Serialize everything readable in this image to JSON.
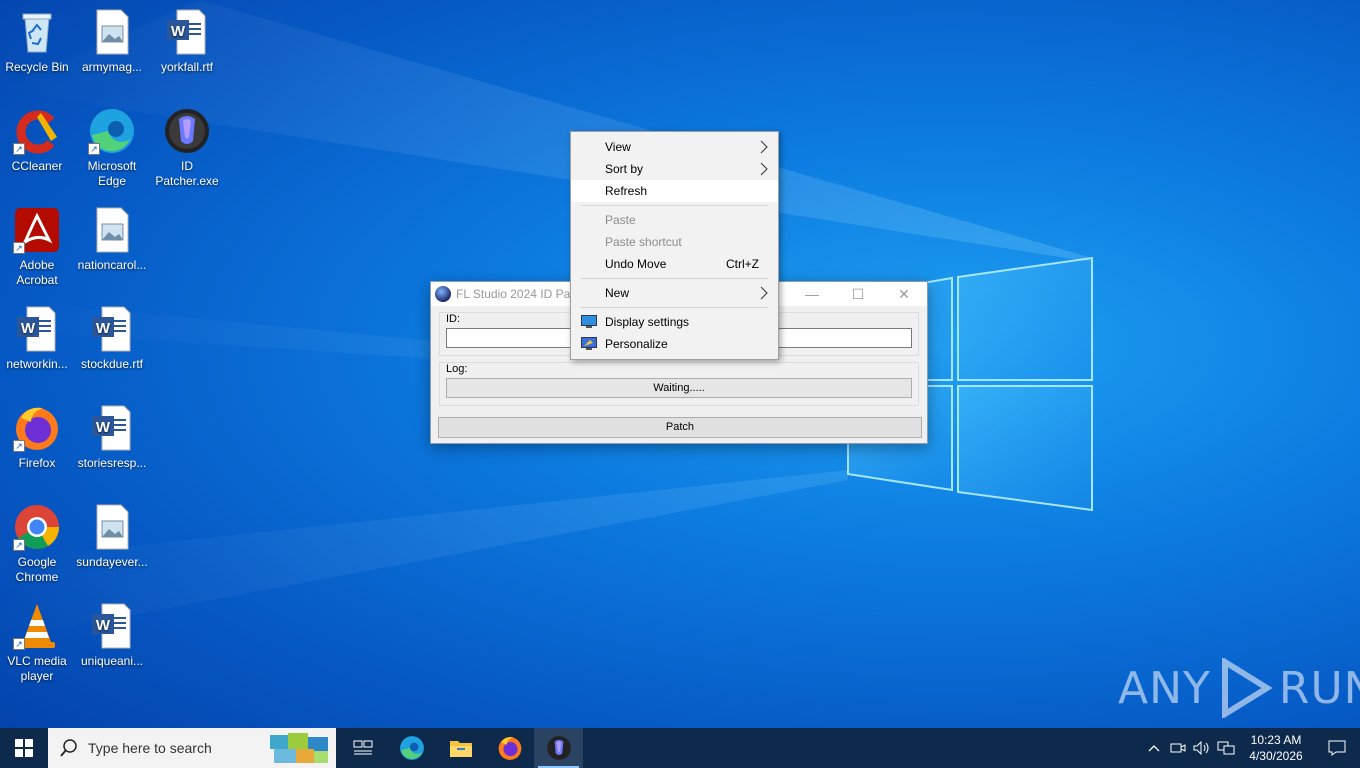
{
  "desktop": {
    "icons": [
      {
        "label": "Recycle Bin",
        "icon": "recycle-bin-icon"
      },
      {
        "label": "armymag...",
        "icon": "image-file-icon"
      },
      {
        "label": "yorkfall.rtf",
        "icon": "word-document-icon"
      },
      {
        "label": "CCleaner",
        "icon": "ccleaner-icon"
      },
      {
        "label": "Microsoft Edge",
        "icon": "edge-icon"
      },
      {
        "label": "ID Patcher.exe",
        "icon": "fl-studio-icon"
      },
      {
        "label": "Adobe Acrobat",
        "icon": "acrobat-icon"
      },
      {
        "label": "nationcarol...",
        "icon": "image-file-icon"
      },
      {
        "label": "networkin...",
        "icon": "word-document-icon"
      },
      {
        "label": "stockdue.rtf",
        "icon": "word-document-icon"
      },
      {
        "label": "Firefox",
        "icon": "firefox-icon"
      },
      {
        "label": "storiesresp...",
        "icon": "word-document-icon"
      },
      {
        "label": "Google Chrome",
        "icon": "chrome-icon"
      },
      {
        "label": "sundayever...",
        "icon": "image-file-icon"
      },
      {
        "label": "VLC media player",
        "icon": "vlc-icon"
      },
      {
        "label": "uniqueani...",
        "icon": "word-document-icon"
      }
    ]
  },
  "patcher": {
    "title": "FL Studio 2024 ID Patc",
    "id_label": "ID:",
    "id_value": "",
    "log_label": "Log:",
    "log_value": "Waiting.....",
    "patch_label": "Patch"
  },
  "context_menu": {
    "items": [
      {
        "label": "View",
        "submenu": true
      },
      {
        "label": "Sort by",
        "submenu": true
      },
      {
        "label": "Refresh",
        "hover": true
      },
      {
        "label": "Paste",
        "disabled": true
      },
      {
        "label": "Paste shortcut",
        "disabled": true
      },
      {
        "label": "Undo Move",
        "shortcut": "Ctrl+Z"
      },
      {
        "label": "New",
        "submenu": true
      },
      {
        "label": "Display settings",
        "icon": "display-icon"
      },
      {
        "label": "Personalize",
        "icon": "personalize-icon"
      }
    ]
  },
  "taskbar": {
    "search_placeholder": "Type here to search",
    "apps": [
      "task-view",
      "edge",
      "file-explorer",
      "firefox",
      "fl-patcher"
    ],
    "time": "10:23 AM",
    "date": "4/30/2026"
  },
  "watermark": {
    "left": "ANY",
    "right": "RUN"
  }
}
